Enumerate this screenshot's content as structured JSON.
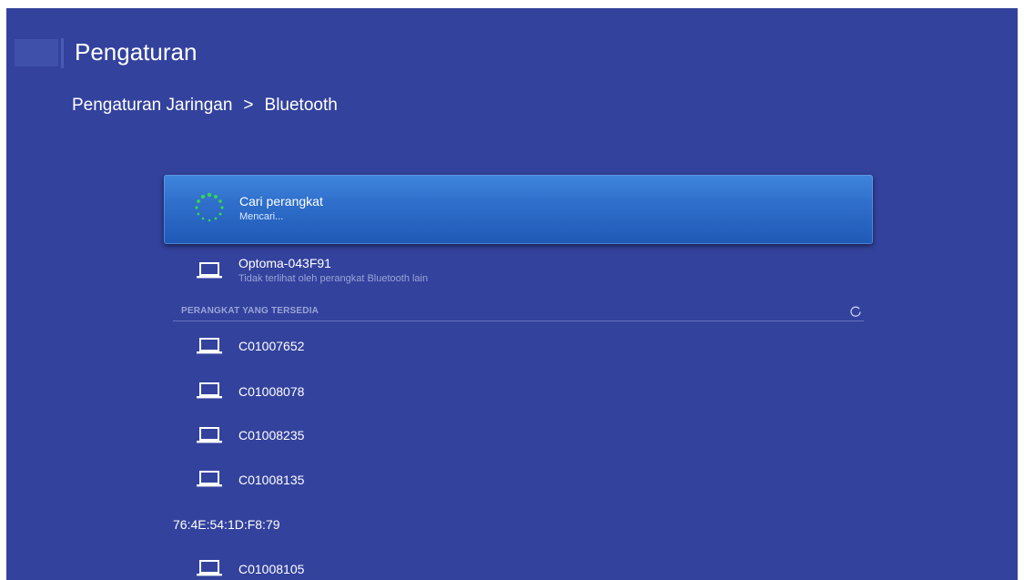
{
  "header": {
    "title": "Pengaturan"
  },
  "breadcrumb": {
    "parent": "Pengaturan Jaringan",
    "separator": ">",
    "current": "Bluetooth"
  },
  "search_row": {
    "title": "Cari perangkat",
    "status": "Mencari...",
    "icon": "searching-spinner-icon",
    "spinner_color": "#35d84a"
  },
  "this_device": {
    "name": "Optoma-043F91",
    "visibility": "Tidak terlihat oleh perangkat Bluetooth lain",
    "icon": "laptop-icon"
  },
  "available_section": {
    "header": "PERANGKAT YANG TERSEDIA",
    "icon": "refresh-icon",
    "devices": [
      {
        "name": "C01007652",
        "icon": "laptop-icon"
      },
      {
        "name": "C01008078",
        "icon": "laptop-icon"
      },
      {
        "name": "C01008235",
        "icon": "laptop-icon"
      },
      {
        "name": "C01008135",
        "icon": "laptop-icon"
      },
      {
        "name": "76:4E:54:1D:F8:79",
        "icon": ""
      },
      {
        "name": "C01008105",
        "icon": "laptop-icon"
      }
    ]
  },
  "colors": {
    "background": "#33429d",
    "selected": "#2f6fcb",
    "secondary_text": "#9aa4d6"
  }
}
